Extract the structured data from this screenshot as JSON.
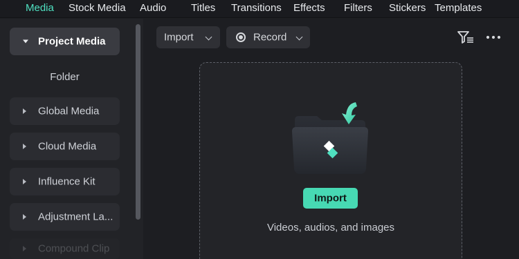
{
  "tabs": [
    {
      "label": "Media",
      "active": true
    },
    {
      "label": "Stock Media"
    },
    {
      "label": "Audio"
    },
    {
      "label": "Titles"
    },
    {
      "label": "Transitions"
    },
    {
      "label": "Effects"
    },
    {
      "label": "Filters"
    },
    {
      "label": "Stickers"
    },
    {
      "label": "Templates"
    }
  ],
  "sidebar": {
    "project_media": "Project Media",
    "folder": "Folder",
    "items": [
      {
        "label": "Global Media"
      },
      {
        "label": "Cloud Media"
      },
      {
        "label": "Influence Kit"
      },
      {
        "label": "Adjustment La..."
      },
      {
        "label": "Compound Clip"
      }
    ]
  },
  "toolbar": {
    "import_label": "Import",
    "record_label": "Record",
    "icons": [
      "chevron-down-icon",
      "record-icon",
      "filter-icon",
      "more-icon"
    ]
  },
  "dropzone": {
    "button_label": "Import",
    "hint": "Videos, audios, and images"
  },
  "colors": {
    "accent": "#4fe0c0",
    "button": "#47d9b3",
    "background": "#1d1e22",
    "sidebar": "#222327"
  }
}
